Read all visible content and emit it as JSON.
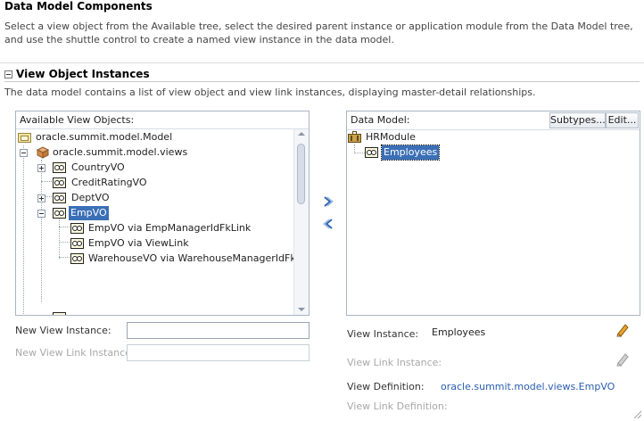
{
  "header": {
    "title": "Data Model Components",
    "description": "Select a view object from the Available tree, select the desired parent instance or application module from the Data Model tree, and use the shuttle control to create a named view instance in the data model."
  },
  "section": {
    "title": "View Object Instances",
    "toggle": "collapse",
    "description": "The data model contains a list of view object and view link instances, displaying master-detail relationships."
  },
  "available": {
    "label": "Available View Objects:",
    "items": [
      {
        "label": "oracle.summit.model.Model"
      },
      {
        "label": "oracle.summit.model.views"
      },
      {
        "label": "CountryVO"
      },
      {
        "label": "CreditRatingVO"
      },
      {
        "label": "DeptVO"
      },
      {
        "label": "EmpVO",
        "selected": true
      },
      {
        "label": "EmpVO via EmpManagerIdFkLink"
      },
      {
        "label": "EmpVO via ViewLink"
      },
      {
        "label": "WarehouseVO via WarehouseManagerIdFkLink"
      }
    ]
  },
  "shuttle": {
    "add_icon": "chevron-right-icon",
    "remove_icon": "chevron-left-icon"
  },
  "data_model": {
    "label": "Data Model:",
    "subtypes_button": "Subtypes...",
    "edit_button": "Edit...",
    "items": [
      {
        "label": "HRModule"
      },
      {
        "label": "Employees",
        "selected": true
      }
    ]
  },
  "new_view_instance": {
    "label": "New View Instance:",
    "value": ""
  },
  "new_view_link_instance": {
    "label": "New View Link Instance:",
    "value": ""
  },
  "details": {
    "view_instance_label": "View Instance:",
    "view_instance_value": "Employees",
    "view_link_instance_label": "View Link Instance:",
    "view_definition_label": "View Definition:",
    "view_definition_value": "oracle.summit.model.views.EmpVO",
    "view_link_definition_label": "View Link Definition:"
  },
  "colors": {
    "selection": "#3b6fb6",
    "link": "#2a5db0",
    "panel_border": "#a9b5c4"
  }
}
